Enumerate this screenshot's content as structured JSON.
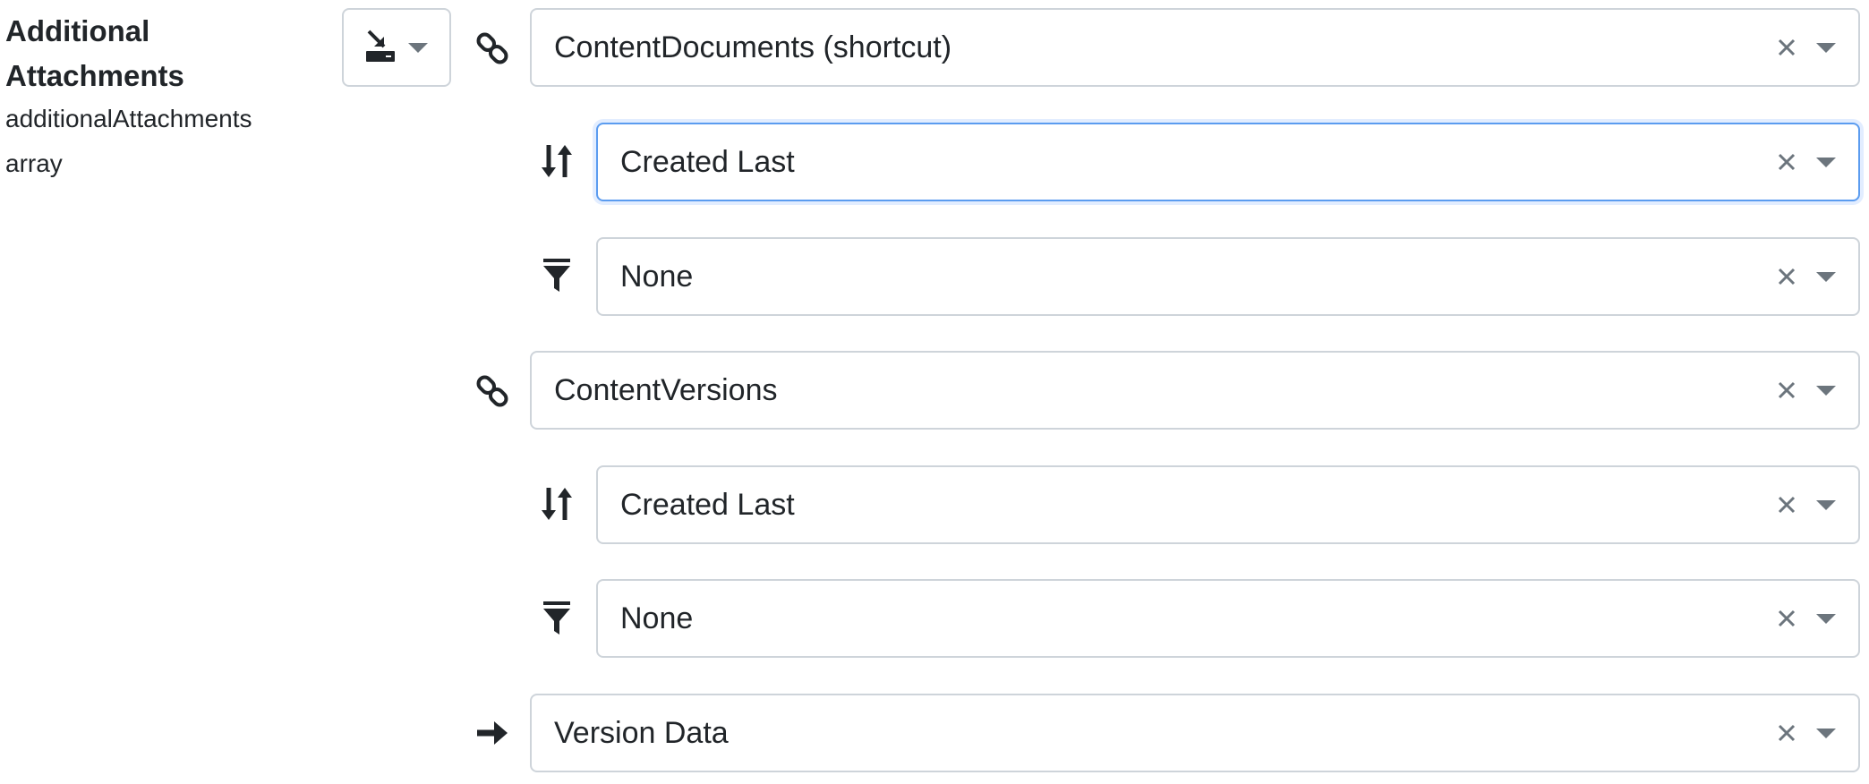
{
  "field": {
    "title": "Additional Attachments",
    "key": "additionalAttachments",
    "type": "array"
  },
  "mode_button": {
    "icon": "map-input-icon"
  },
  "rows": [
    {
      "icon": "link-icon",
      "value": "ContentDocuments (shortcut)"
    },
    {
      "icon": "sort-icon",
      "value": "Created Last",
      "focused": true
    },
    {
      "icon": "filter-icon",
      "value": "None"
    },
    {
      "icon": "link-icon",
      "value": "ContentVersions"
    },
    {
      "icon": "sort-icon",
      "value": "Created Last"
    },
    {
      "icon": "filter-icon",
      "value": "None"
    },
    {
      "icon": "arrow-right-icon",
      "value": "Version Data"
    }
  ],
  "colors": {
    "text": "#212529",
    "border": "#ced4da",
    "focus_border": "#5b9cf0",
    "control_gray": "#6c757d"
  }
}
